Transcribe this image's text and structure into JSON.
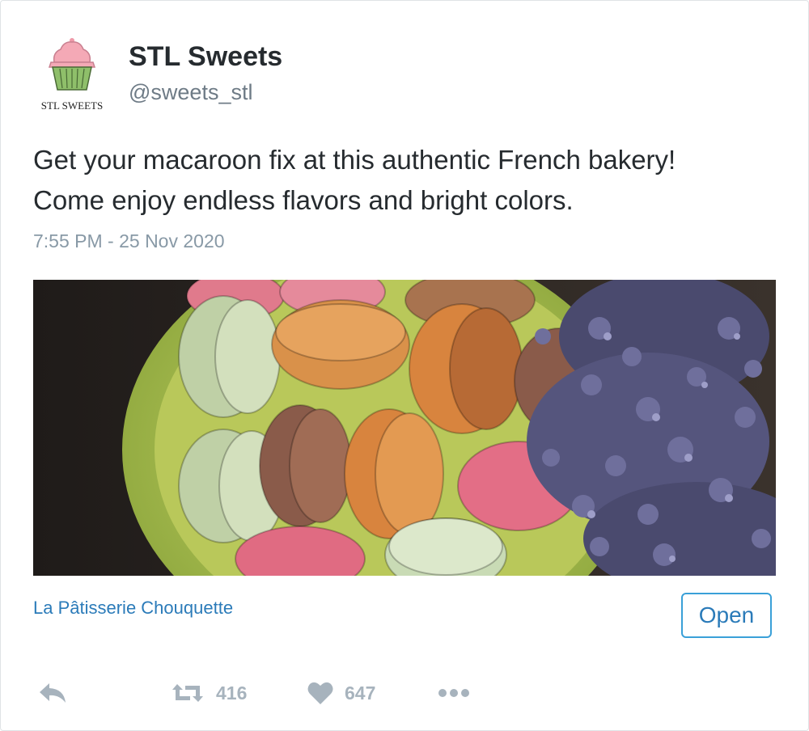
{
  "tweet": {
    "display_name": "STL Sweets",
    "handle": "@sweets_stl",
    "text_line1": "Get your macaroon fix at this authentic French bakery!",
    "text_line2": "Come enjoy endless flavors and bright colors.",
    "timestamp": "7:55 PM - 25 Nov 2020",
    "avatar_text": "STL SWEETS",
    "avatar_icon": "cupcake-logo"
  },
  "link_card": {
    "title": "La Pâtisserie Chouquette",
    "open_label": "Open",
    "image_description": "macarons-in-green-bowl-with-lavender"
  },
  "actions": {
    "reply_icon": "reply-icon",
    "retweet_icon": "retweet-icon",
    "retweet_count": "416",
    "like_icon": "heart-icon",
    "like_count": "647",
    "more_icon": "more-dots-icon"
  },
  "colors": {
    "text_primary": "#262b2f",
    "text_secondary": "#8899a6",
    "link": "#2b7bb9",
    "button_border": "#3aa0d8",
    "action_gray": "#a7b3bd"
  }
}
